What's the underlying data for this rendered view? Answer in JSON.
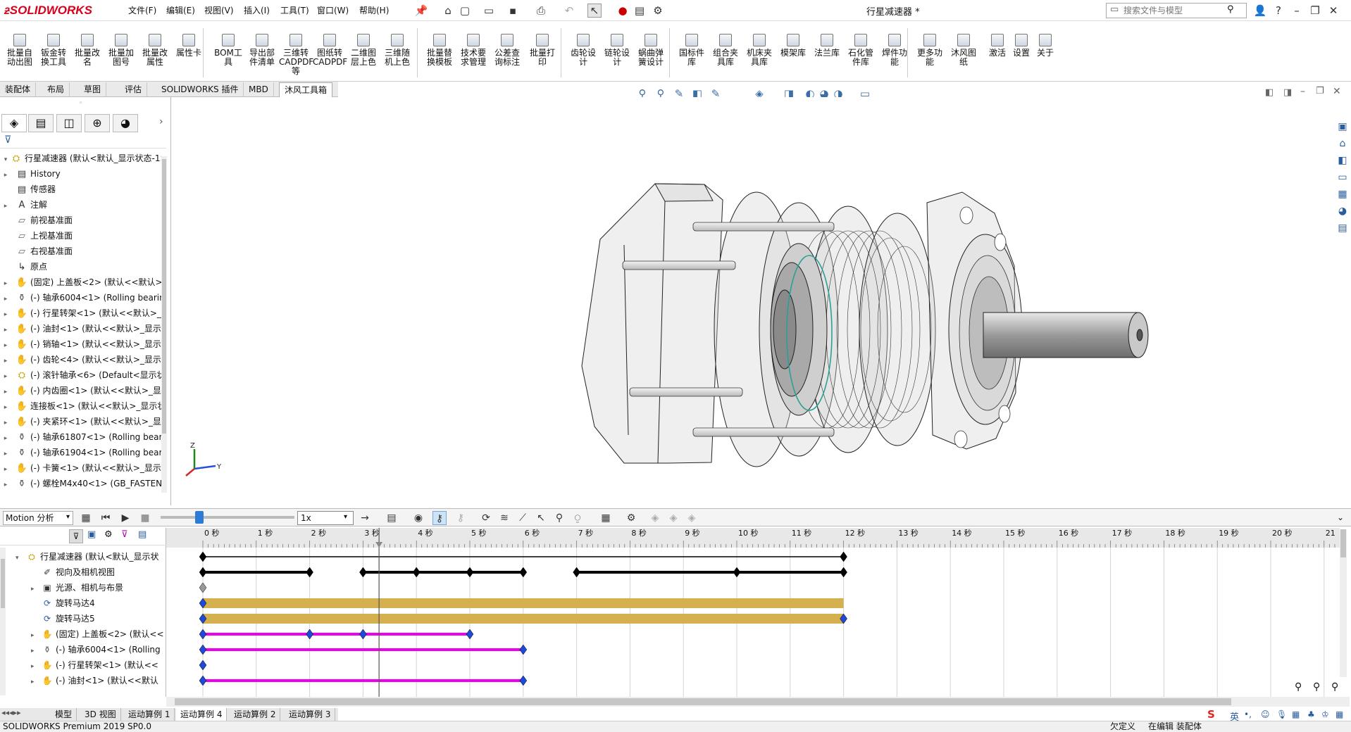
{
  "app": {
    "logo": "SOLIDWORKS",
    "document_title": "行星减速器 *"
  },
  "menu": [
    "文件(F)",
    "编辑(E)",
    "视图(V)",
    "插入(I)",
    "工具(T)",
    "窗口(W)",
    "帮助(H)"
  ],
  "search": {
    "placeholder": "搜索文件与模型"
  },
  "ribbon": [
    {
      "l1": "批量自",
      "l2": "动出图"
    },
    {
      "l1": "钣金转",
      "l2": "换工具"
    },
    {
      "l1": "批量改",
      "l2": "名"
    },
    {
      "l1": "批量加",
      "l2": "图号"
    },
    {
      "l1": "批量改",
      "l2": "属性"
    },
    {
      "l1": "属性卡",
      "l2": ""
    },
    {
      "l1": "BOM工",
      "l2": "具"
    },
    {
      "l1": "导出部",
      "l2": "件清单"
    },
    {
      "l1": "三维转",
      "l2": "CADPDF等"
    },
    {
      "l1": "图纸转",
      "l2": "CADPDF"
    },
    {
      "l1": "二维图",
      "l2": "层上色"
    },
    {
      "l1": "三维随",
      "l2": "机上色"
    },
    {
      "l1": "批量替",
      "l2": "换模板"
    },
    {
      "l1": "技术要",
      "l2": "求管理"
    },
    {
      "l1": "公差查",
      "l2": "询标注"
    },
    {
      "l1": "批量打",
      "l2": "印"
    },
    {
      "l1": "齿轮设",
      "l2": "计"
    },
    {
      "l1": "链轮设",
      "l2": "计"
    },
    {
      "l1": "蜗曲弹",
      "l2": "簧设计"
    },
    {
      "l1": "国标件",
      "l2": "库"
    },
    {
      "l1": "组合夹",
      "l2": "具库"
    },
    {
      "l1": "机床夹",
      "l2": "具库"
    },
    {
      "l1": "模架库",
      "l2": ""
    },
    {
      "l1": "法兰库",
      "l2": ""
    },
    {
      "l1": "石化管",
      "l2": "件库"
    },
    {
      "l1": "焊件功",
      "l2": "能"
    },
    {
      "l1": "更多功",
      "l2": "能"
    },
    {
      "l1": "沐风图",
      "l2": "纸"
    },
    {
      "l1": "激活",
      "l2": ""
    },
    {
      "l1": "设置",
      "l2": ""
    },
    {
      "l1": "关于",
      "l2": ""
    }
  ],
  "cm_tabs": [
    "装配体",
    "布局",
    "草图",
    "评估",
    "SOLIDWORKS 插件",
    "MBD",
    "沐风工具箱"
  ],
  "tree": [
    {
      "label": "行星减速器 (默认<默认_显示状态-1>",
      "icon": "assembly-icon",
      "arrow": "▾"
    },
    {
      "label": "History",
      "icon": "history-icon",
      "arrow": "▸"
    },
    {
      "label": "传感器",
      "icon": "sensor-icon",
      "arrow": ""
    },
    {
      "label": "注解",
      "icon": "annotation-icon",
      "arrow": "▸"
    },
    {
      "label": "前视基准面",
      "icon": "plane-icon",
      "arrow": ""
    },
    {
      "label": "上视基准面",
      "icon": "plane-icon",
      "arrow": ""
    },
    {
      "label": "右视基准面",
      "icon": "plane-icon",
      "arrow": ""
    },
    {
      "label": "原点",
      "icon": "origin-icon",
      "arrow": ""
    },
    {
      "label": "(固定) 上盖板<2> (默认<<默认>",
      "icon": "part-icon",
      "arrow": "▸"
    },
    {
      "label": "(-) 轴承6004<1> (Rolling bearin",
      "icon": "bearing-icon",
      "arrow": "▸"
    },
    {
      "label": "(-) 行星转架<1> (默认<<默认>_",
      "icon": "part-icon",
      "arrow": "▸"
    },
    {
      "label": "(-) 油封<1> (默认<<默认>_显示",
      "icon": "part-icon",
      "arrow": "▸"
    },
    {
      "label": "(-) 销轴<1> (默认<<默认>_显示",
      "icon": "part-icon",
      "arrow": "▸"
    },
    {
      "label": "(-) 齿轮<4> (默认<<默认>_显示",
      "icon": "part-icon",
      "arrow": "▸"
    },
    {
      "label": "(-) 滚针轴承<6> (Default<显示状",
      "icon": "assembly-icon",
      "arrow": "▸"
    },
    {
      "label": "(-) 内齿圈<1> (默认<<默认>_显",
      "icon": "part-icon",
      "arrow": "▸"
    },
    {
      "label": "连接板<1> (默认<<默认>_显示状",
      "icon": "part-icon",
      "arrow": "▸"
    },
    {
      "label": "(-) 夹紧环<1> (默认<<默认>_显",
      "icon": "part-icon",
      "arrow": "▸"
    },
    {
      "label": "(-) 轴承61807<1> (Rolling bear",
      "icon": "bearing-icon",
      "arrow": "▸"
    },
    {
      "label": "(-) 轴承61904<1> (Rolling bear",
      "icon": "bearing-icon",
      "arrow": "▸"
    },
    {
      "label": "(-) 卡簧<1> (默认<<默认>_显示",
      "icon": "part-icon",
      "arrow": "▸"
    },
    {
      "label": "(-) 螺栓M4x40<1> (GB_FASTEN",
      "icon": "bearing-icon",
      "arrow": "▸"
    }
  ],
  "motion": {
    "type": "Motion 分析",
    "speed": "1x"
  },
  "timeline_rows": [
    {
      "label": "行星减速器 (默认<默认_显示状",
      "icon": "assembly-icon",
      "arrow": "▾",
      "indent": 0
    },
    {
      "label": "视向及相机视图",
      "icon": "camera-icon",
      "arrow": "",
      "indent": 1
    },
    {
      "label": "光源、相机与布景",
      "icon": "lights-icon",
      "arrow": "▸",
      "indent": 1
    },
    {
      "label": "旋转马达4",
      "icon": "motor-icon",
      "arrow": "",
      "indent": 1
    },
    {
      "label": "旋转马达5",
      "icon": "motor-icon",
      "arrow": "",
      "indent": 1
    },
    {
      "label": "(固定) 上盖板<2> (默认<<",
      "icon": "part-icon",
      "arrow": "▸",
      "indent": 1
    },
    {
      "label": "(-) 轴承6004<1> (Rolling",
      "icon": "bearing-icon",
      "arrow": "▸",
      "indent": 1
    },
    {
      "label": "(-) 行星转架<1> (默认<<",
      "icon": "part-icon",
      "arrow": "▸",
      "indent": 1
    },
    {
      "label": "(-) 油封<1> (默认<<默认",
      "icon": "part-icon",
      "arrow": "▸",
      "indent": 1
    }
  ],
  "ruler_labels": [
    "0 秒",
    "1 秒",
    "2 秒",
    "3 秒",
    "4 秒",
    "5 秒",
    "6 秒",
    "7 秒",
    "8 秒",
    "9 秒",
    "10 秒",
    "11 秒",
    "12 秒",
    "13 秒",
    "14 秒",
    "15 秒",
    "16 秒",
    "17 秒",
    "18 秒",
    "19 秒",
    "20 秒",
    "21"
  ],
  "timeline_tracks": [
    {
      "kind": "thin",
      "color": "#000000",
      "segments": [
        [
          0,
          12
        ]
      ],
      "keys": [
        0,
        12
      ]
    },
    {
      "kind": "bold",
      "color": "#000000",
      "segments": [
        [
          0,
          2
        ],
        [
          3,
          6
        ],
        [
          7,
          12
        ]
      ],
      "keys": [
        0,
        2,
        3,
        4,
        5,
        6,
        7,
        10,
        12
      ]
    },
    {
      "kind": "key",
      "color": "#999999",
      "segments": [],
      "keys": [
        0
      ]
    },
    {
      "kind": "bar",
      "color": "#d4b04f",
      "segments": [
        [
          0,
          12
        ]
      ],
      "keys": [
        0
      ]
    },
    {
      "kind": "bar",
      "color": "#d4b04f",
      "segments": [
        [
          0,
          12
        ]
      ],
      "keys": [
        0,
        12
      ]
    },
    {
      "kind": "bold",
      "color": "#ee00ee",
      "segments": [
        [
          0,
          5
        ]
      ],
      "keys": [
        0,
        2,
        3,
        5
      ]
    },
    {
      "kind": "bold",
      "color": "#ee00ee",
      "segments": [
        [
          0,
          6
        ]
      ],
      "keys": [
        0,
        6
      ]
    },
    {
      "kind": "key",
      "color": "#1f49d6",
      "segments": [],
      "keys": [
        0
      ]
    },
    {
      "kind": "bold",
      "color": "#ee00ee",
      "segments": [
        [
          0,
          6
        ]
      ],
      "keys": [
        0,
        6
      ]
    }
  ],
  "playhead_seconds": 3.3,
  "status_tabs": [
    "模型",
    "3D 视图",
    "运动算例 1",
    "运动算例 4",
    "运动算例 2",
    "运动算例 3"
  ],
  "status": {
    "left": "SOLIDWORKS Premium 2019 SP0.0",
    "undef": "欠定义",
    "editing": "在编辑 装配体"
  },
  "ime": {
    "lang": "英"
  },
  "colors": {
    "brand": "#d6001c",
    "motor": "#d4b04f",
    "key_blue": "#1f49d6",
    "magenta": "#ee00ee"
  }
}
